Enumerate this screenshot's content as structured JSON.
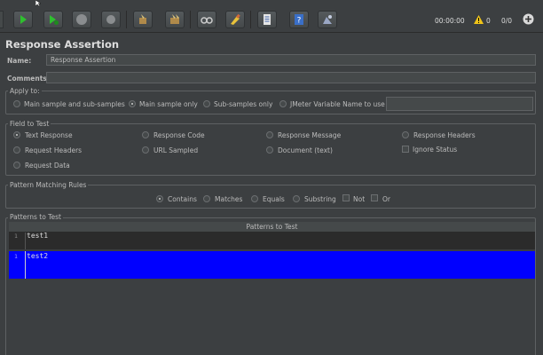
{
  "toolbar": {
    "icons": [
      "start-icon",
      "start-no-pauses-icon",
      "stop-icon",
      "shutdown-icon",
      "clear-icon",
      "clear-all-icon",
      "search-icon",
      "reset-search-icon",
      "function-helper-icon",
      "help-icon",
      "remote-icon"
    ],
    "timer": "00:00:00",
    "warning_count": "0",
    "thread_count": "0/0"
  },
  "panel": {
    "title": "Response Assertion",
    "name_label": "Name:",
    "name_value": "Response Assertion",
    "comments_label": "Comments:",
    "comments_value": ""
  },
  "apply_to": {
    "legend": "Apply to:",
    "options": [
      "Main sample and sub-samples",
      "Main sample only",
      "Sub-samples only",
      "JMeter Variable Name to use"
    ],
    "selected": "Main sample only",
    "variable_value": ""
  },
  "field_to_test": {
    "legend": "Field to Test",
    "options": [
      "Text Response",
      "Response Code",
      "Response Message",
      "Response Headers",
      "Request Headers",
      "URL Sampled",
      "Document (text)",
      "Request Data"
    ],
    "selected": "Text Response",
    "ignore_status_label": "Ignore Status",
    "ignore_status_checked": false
  },
  "pattern_rules": {
    "legend": "Pattern Matching Rules",
    "options": [
      "Contains",
      "Matches",
      "Equals",
      "Substring"
    ],
    "selected": "Contains",
    "not_label": "Not",
    "or_label": "Or"
  },
  "patterns": {
    "legend": "Patterns to Test",
    "column_header": "Patterns to Test",
    "rows": [
      {
        "line": "1",
        "text": "test1"
      },
      {
        "line": "1",
        "text": "test2"
      }
    ]
  },
  "colors": {
    "background": "#3c3f41",
    "selected_row": "#0000ff",
    "start_green": "#2fbf2f"
  }
}
